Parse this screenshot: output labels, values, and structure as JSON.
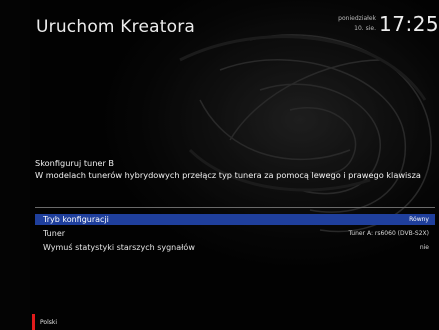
{
  "header": {
    "title": "Uruchom Kreatora",
    "day": "poniedziałek",
    "date": "10. sie.",
    "time": "17:25"
  },
  "description": "Skonfiguruj tuner B\nW modelach tunerów hybrydowych przełącz typ tunera za pomocą lewego i prawego klawisza",
  "menu": [
    {
      "label": "Tryb konfiguracji",
      "value": "Równy",
      "selected": true
    },
    {
      "label": "Tuner",
      "value": "Tuner A: rs6060 (DVB-S2X)",
      "selected": false
    },
    {
      "label": "Wymuś statystyki starszych sygnałów",
      "value": "nie",
      "selected": false
    }
  ],
  "footer": {
    "language": "Polski"
  },
  "colors": {
    "selection": "#1f3f9c",
    "accent": "#e11b1b"
  }
}
